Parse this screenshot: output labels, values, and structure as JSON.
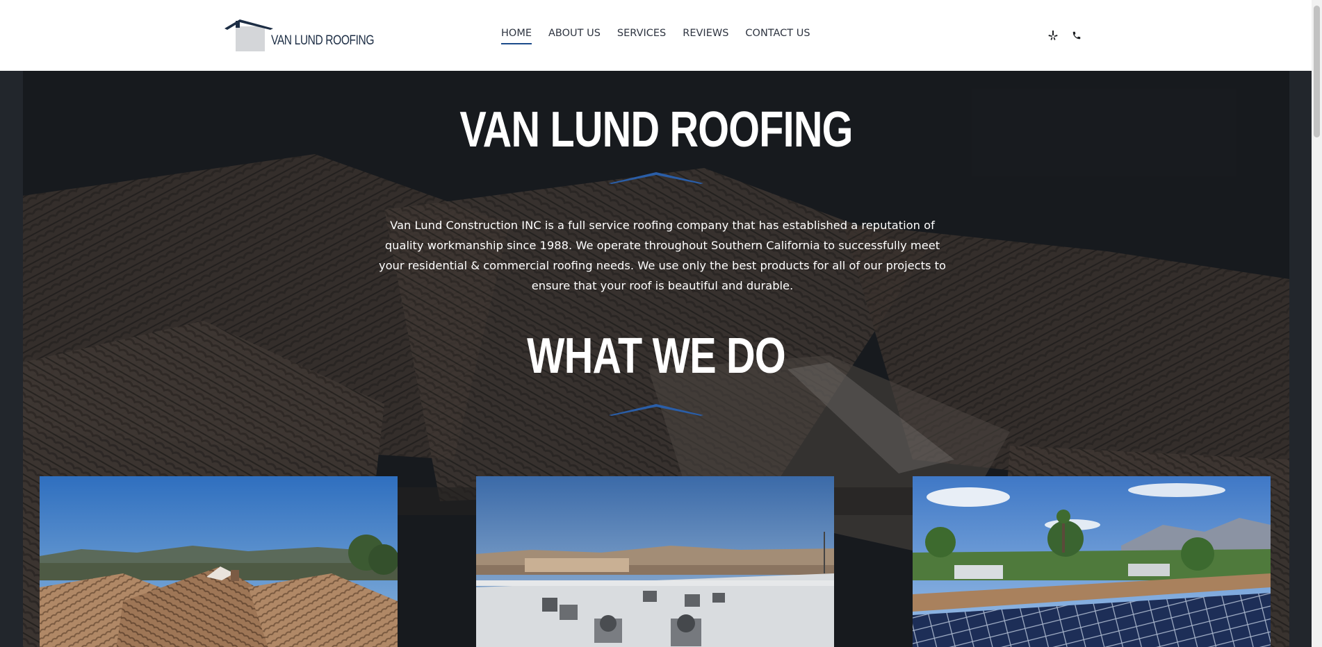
{
  "header": {
    "logo_text": "VAN LUND ROOFING",
    "nav": [
      {
        "label": "HOME",
        "active": true
      },
      {
        "label": "ABOUT US",
        "active": false
      },
      {
        "label": "SERVICES",
        "active": false
      },
      {
        "label": "REVIEWS",
        "active": false
      },
      {
        "label": "CONTACT US",
        "active": false
      }
    ],
    "icons": [
      "yelp-icon",
      "phone-icon"
    ]
  },
  "hero": {
    "title": "VAN LUND ROOFING",
    "description": "Van Lund Construction INC is a full service roofing company that has established a reputation of quality workmanship since 1988. We operate throughout Southern California to successfully meet your residential & commercial roofing needs. We use only the best products for all of our projects to ensure that your roof is beautiful and durable.",
    "section_title": "WHAT WE DO"
  },
  "services": [
    {
      "name": "tile-roof-photo"
    },
    {
      "name": "commercial-flat-roof-photo"
    },
    {
      "name": "solar-panel-roof-photo"
    }
  ],
  "colors": {
    "accent": "#1b4b8a",
    "logo": "#1c2d44",
    "hero_dark": "#16191d"
  }
}
